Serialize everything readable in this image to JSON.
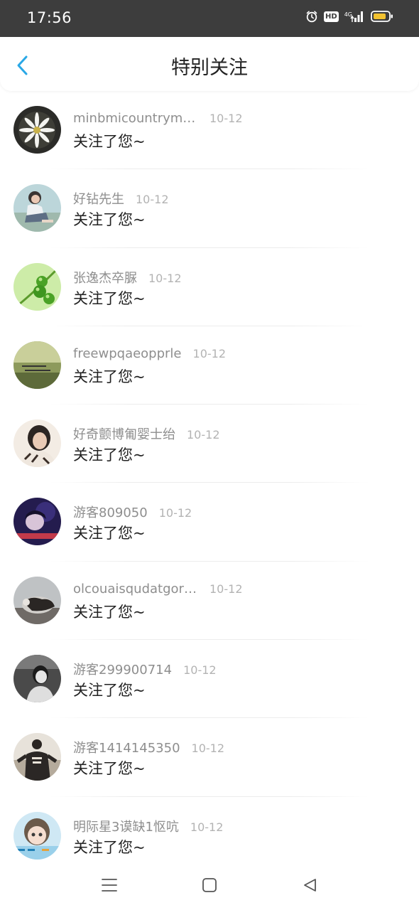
{
  "status_bar": {
    "time": "17:56",
    "hd": "HD",
    "network": "4G",
    "icons": [
      "alarm-icon",
      "hd-icon",
      "signal-icon",
      "battery-icon"
    ]
  },
  "header": {
    "title": "特别关注",
    "back_icon": "chevron-left-icon",
    "accent_color": "#2aa8e6"
  },
  "items": [
    {
      "name": "minbmicountryma...",
      "date": "10-12",
      "message": "关注了您~",
      "avatar": "flower"
    },
    {
      "name": "好钻先生",
      "date": "10-12",
      "message": "关注了您~",
      "avatar": "person-sitting"
    },
    {
      "name": "张逸杰卒脲",
      "date": "10-12",
      "message": "关注了您~",
      "avatar": "green-fruit"
    },
    {
      "name": "freewpqaeopprle",
      "date": "10-12",
      "message": "关注了您~",
      "avatar": "text-on-field"
    },
    {
      "name": "好奇颤博匍婴士绐",
      "date": "10-12",
      "message": "关注了您~",
      "avatar": "girl-portrait"
    },
    {
      "name": "游客809050",
      "date": "10-12",
      "message": "关注了您~",
      "avatar": "dark-portrait"
    },
    {
      "name": "olcouaisqudatgorze",
      "date": "10-12",
      "message": "关注了您~",
      "avatar": "dog"
    },
    {
      "name": "游客299900714",
      "date": "10-12",
      "message": "关注了您~",
      "avatar": "bw-portrait"
    },
    {
      "name": "游客1414145350",
      "date": "10-12",
      "message": "关注了您~",
      "avatar": "hoodie-person"
    },
    {
      "name": "明际星3谟缺1怄吭",
      "date": "10-12",
      "message": "关注了您~",
      "avatar": "cartoon-girl"
    }
  ],
  "nav_bar": {
    "icons": [
      "menu-icon",
      "home-icon",
      "back-triangle-icon"
    ]
  }
}
